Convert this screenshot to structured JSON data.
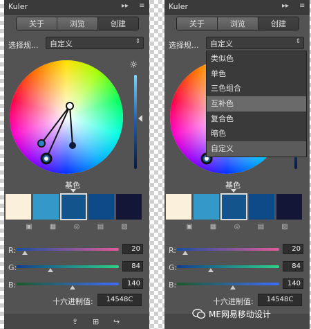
{
  "left_panel": {
    "title": "Kuler",
    "titlebar_buttons": [
      "▸▸",
      "≡"
    ],
    "tabs": [
      "关于",
      "浏览",
      "创建"
    ],
    "active_tab": "创建",
    "rule_label": "选择规...",
    "rule_value": "自定义",
    "base_label": "基色",
    "swatches": [
      "#faf0dc",
      "#3498c9",
      "#14548c",
      "#0d4a87",
      "#141637"
    ],
    "selected_swatch": 2,
    "channels": [
      {
        "label": "R:",
        "value": "20",
        "level": 0.08,
        "gradient": "linear-gradient(90deg,#1a4fa0,#e15c9a)"
      },
      {
        "label": "G:",
        "value": "84",
        "level": 0.33,
        "gradient": "linear-gradient(90deg,#123c8c,#2fd28a)"
      },
      {
        "label": "B:",
        "value": "140",
        "level": 0.55,
        "gradient": "linear-gradient(90deg,#1c5b2a,#3c6cff)"
      }
    ],
    "hex_label": "十六进制值:",
    "hex_value": "14548C"
  },
  "right_panel": {
    "title": "Kuler",
    "titlebar_buttons": [
      "▸▸",
      "≡"
    ],
    "tabs": [
      "关于",
      "浏览",
      "创建"
    ],
    "active_tab": "创建",
    "rule_label": "选择规...",
    "rule_value": "自定义",
    "dropdown_options": [
      "类似色",
      "单色",
      "三色组合",
      "互补色",
      "复合色",
      "暗色",
      "自定义"
    ],
    "hover_option": "互补色",
    "base_label": "基色",
    "swatches": [
      "#faf0dc",
      "#3498c9",
      "#14548c",
      "#0d4a87",
      "#141637"
    ],
    "selected_swatch": 2,
    "channels": [
      {
        "label": "R:",
        "value": "20",
        "level": 0.08,
        "gradient": "linear-gradient(90deg,#1a4fa0,#e15c9a)"
      },
      {
        "label": "G:",
        "value": "84",
        "level": 0.33,
        "gradient": "linear-gradient(90deg,#123c8c,#2fd28a)"
      },
      {
        "label": "B:",
        "value": "140",
        "level": 0.55,
        "gradient": "linear-gradient(90deg,#1c5b2a,#3c6cff)"
      }
    ],
    "hex_label": "十六进制值:",
    "hex_value": "14548C"
  },
  "watermark": "ME网易移动设计"
}
